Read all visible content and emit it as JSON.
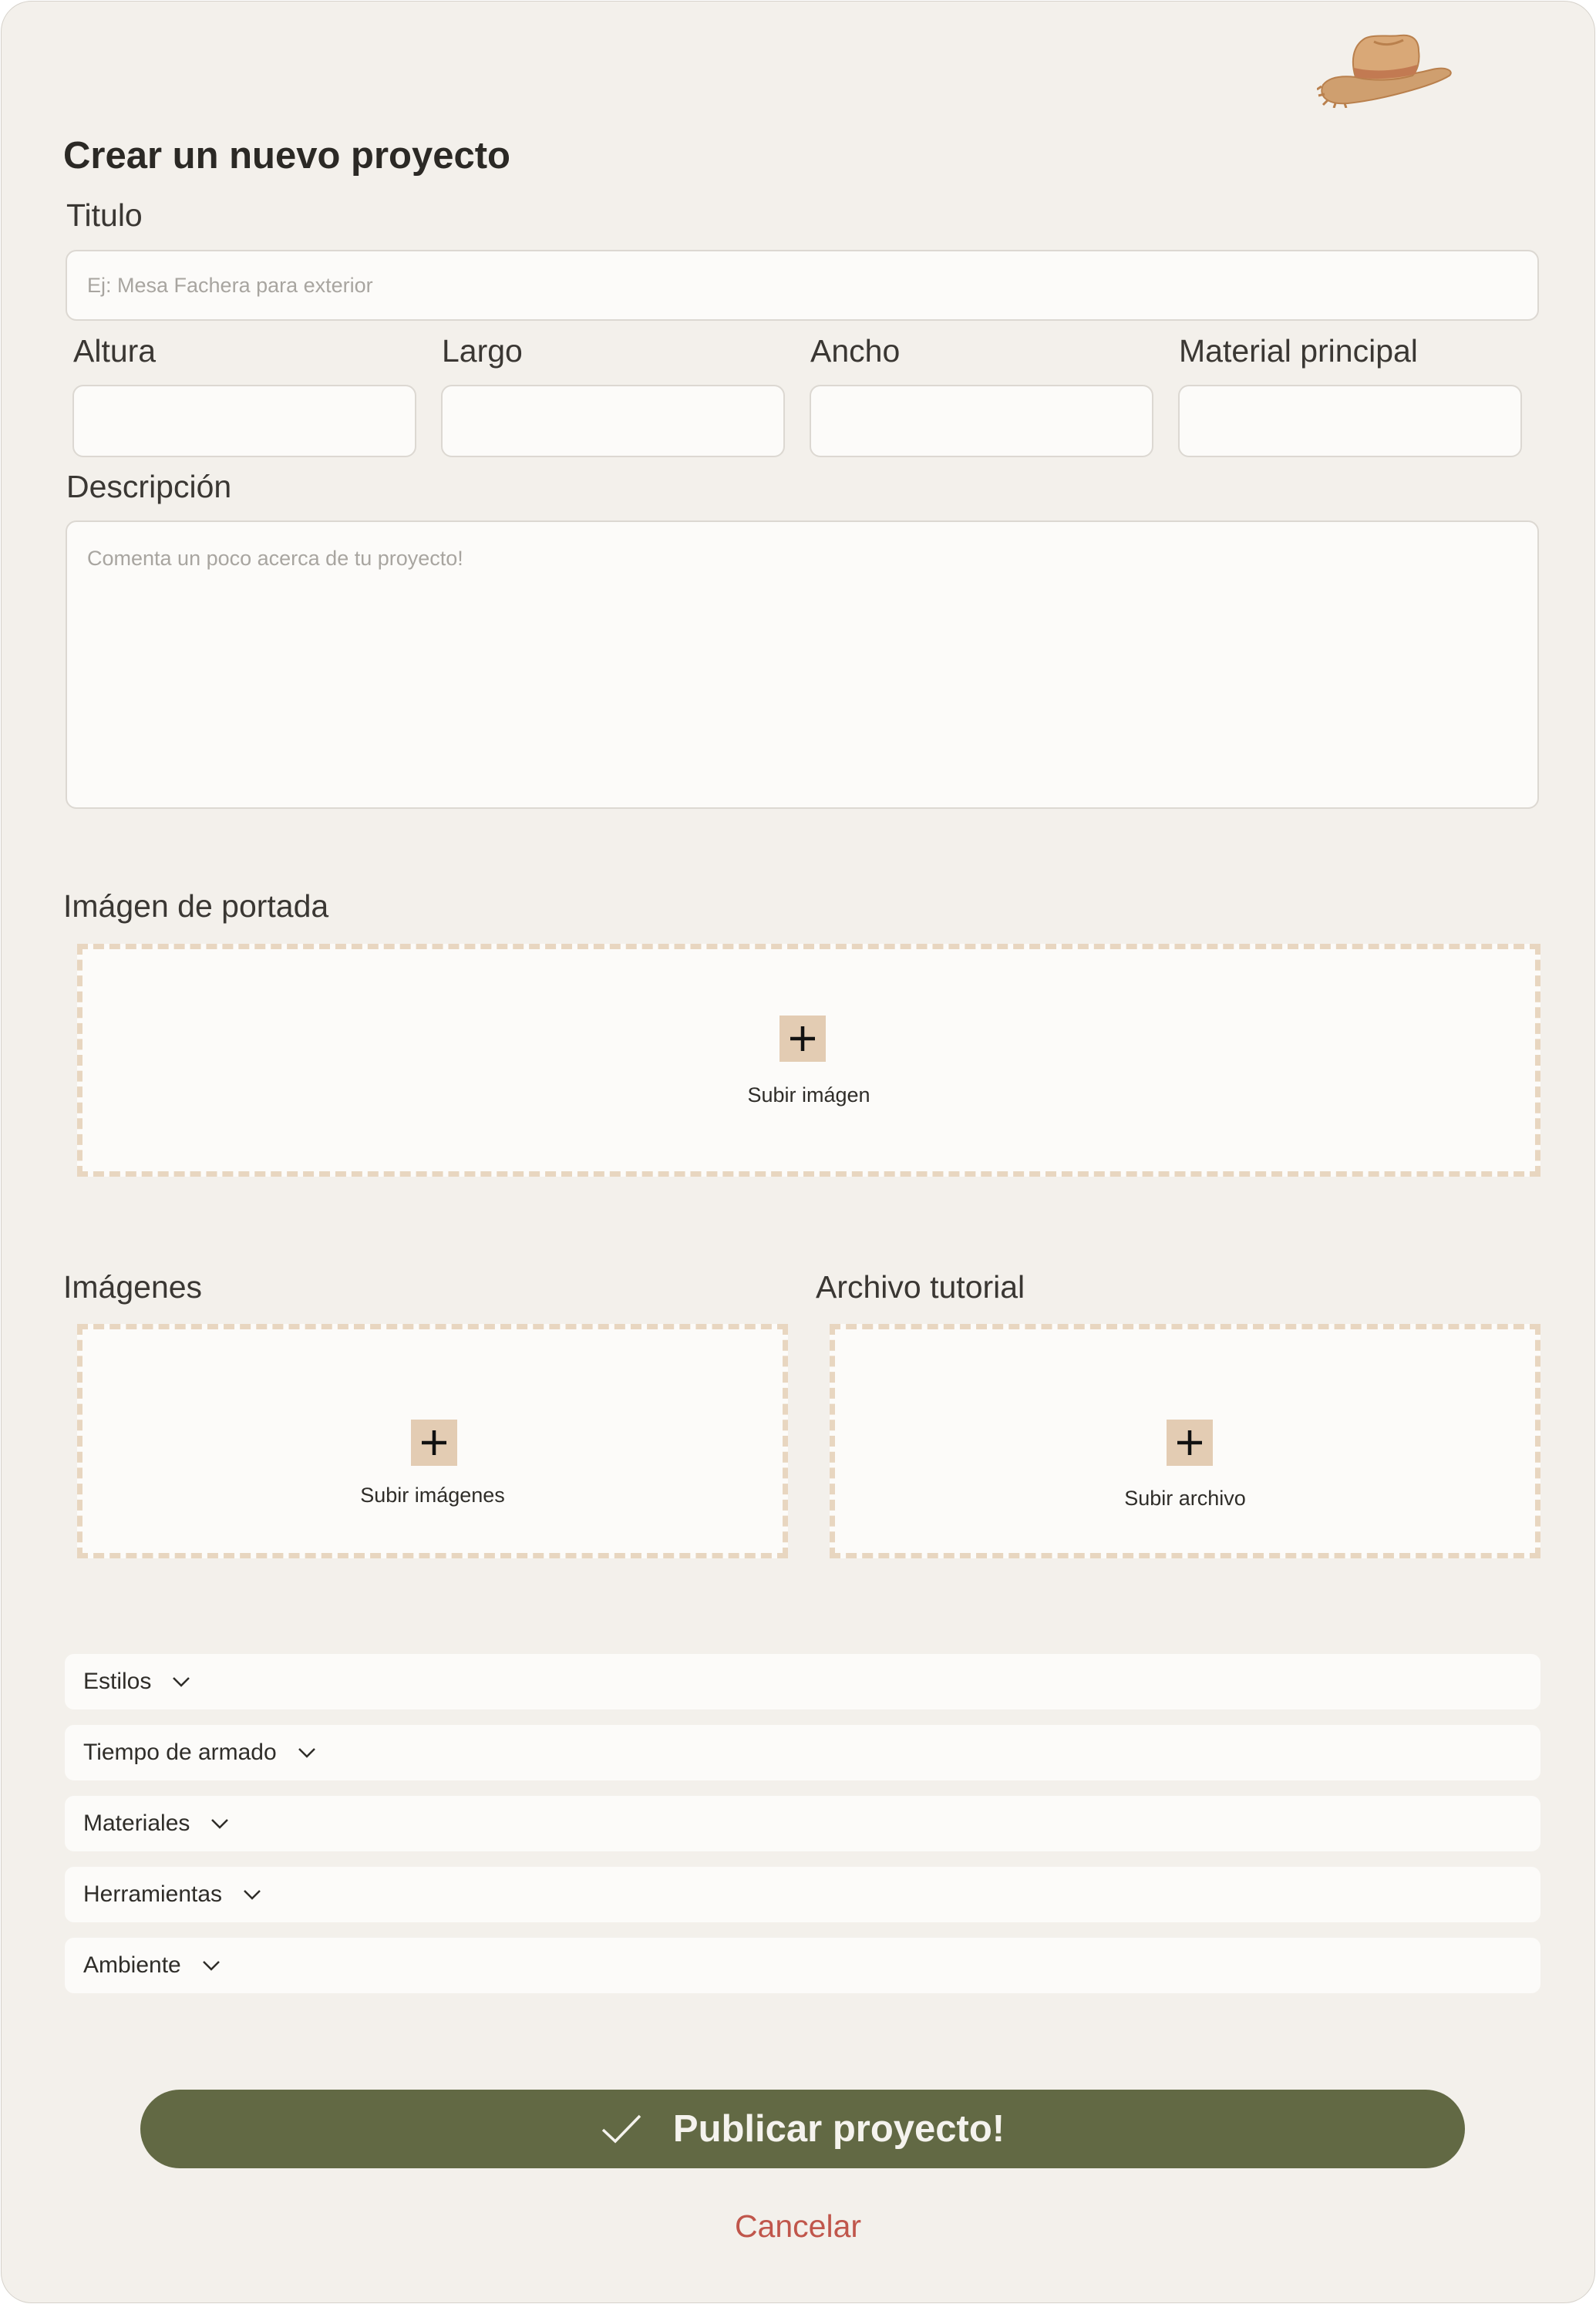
{
  "colors": {
    "background": "#f3f0eb",
    "field_bg": "#fcfbf9",
    "dropzone_border": "#e8d6c0",
    "plus_box": "#e3ccb3",
    "primary_button": "#626944",
    "cancel_text": "#c0564b"
  },
  "header": {
    "logo_icon": "cowboy-hat-icon",
    "title": "Crear un nuevo proyecto"
  },
  "form": {
    "titulo": {
      "label": "Titulo",
      "placeholder": "Ej: Mesa Fachera para exterior",
      "value": ""
    },
    "altura": {
      "label": "Altura",
      "value": ""
    },
    "largo": {
      "label": "Largo",
      "value": ""
    },
    "ancho": {
      "label": "Ancho",
      "value": ""
    },
    "material": {
      "label": "Material principal",
      "value": ""
    },
    "descripcion": {
      "label": "Descripción",
      "placeholder": "Comenta un poco acerca de tu proyecto!",
      "value": ""
    }
  },
  "uploads": {
    "portada": {
      "label": "Imágen de portada",
      "action": "Subir imágen",
      "icon": "plus-icon"
    },
    "imagenes": {
      "label": "Imágenes",
      "action": "Subir imágenes",
      "icon": "plus-icon"
    },
    "archivo": {
      "label": "Archivo tutorial",
      "action": "Subir archivo",
      "icon": "plus-icon"
    }
  },
  "dropdowns": [
    {
      "label": "Estilos",
      "icon": "chevron-down-icon"
    },
    {
      "label": "Tiempo de armado",
      "icon": "chevron-down-icon"
    },
    {
      "label": "Materiales",
      "icon": "chevron-down-icon"
    },
    {
      "label": "Herramientas",
      "icon": "chevron-down-icon"
    },
    {
      "label": "Ambiente",
      "icon": "chevron-down-icon"
    }
  ],
  "actions": {
    "publish_label": "Publicar proyecto!",
    "publish_icon": "check-icon",
    "cancel_label": "Cancelar"
  }
}
